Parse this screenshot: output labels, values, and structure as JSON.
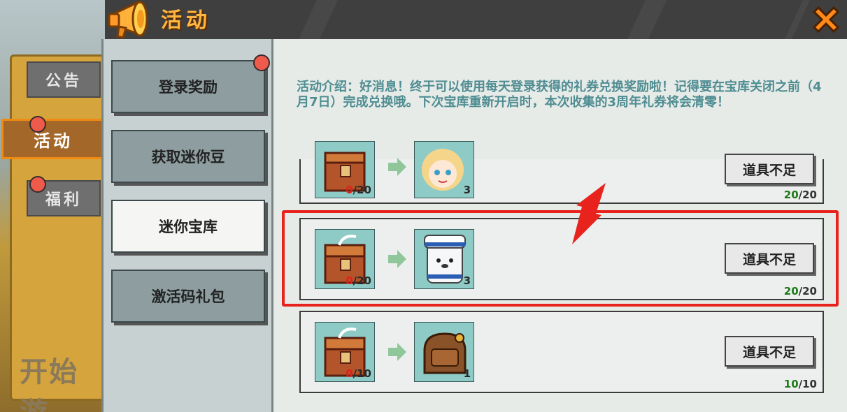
{
  "header": {
    "title": "活动",
    "close_icon": "close-icon"
  },
  "left_tabs": [
    {
      "label": "公告",
      "active": false,
      "dot": false
    },
    {
      "label": "活动",
      "active": true,
      "dot": true
    },
    {
      "label": "福利",
      "active": false,
      "dot": true
    }
  ],
  "background": {
    "start_text": "开始游"
  },
  "nav": [
    {
      "label": "登录奖励",
      "selected": false,
      "dot": true
    },
    {
      "label": "获取迷你豆",
      "selected": false,
      "dot": false
    },
    {
      "label": "迷你宝库",
      "selected": true,
      "dot": false
    },
    {
      "label": "激活码礼包",
      "selected": false,
      "dot": false
    }
  ],
  "intro": "活动介绍：好消息！终于可以使用每天登录获得的礼券兑换奖励啦！记得要在宝库关闭之前（4月7日）完成兑换哦。下次宝库重新开启时，本次收集的3周年礼券将会清零！",
  "rows": [
    {
      "cost_have": "0",
      "cost_need": "/20",
      "reward_count": "3",
      "button": "道具不足",
      "progress_done": "20",
      "progress_total": "/20",
      "reward_icon": "blonde-girl-avatar-icon"
    },
    {
      "cost_have": "0",
      "cost_need": "/20",
      "reward_count": "3",
      "button": "道具不足",
      "progress_done": "20",
      "progress_total": "/20",
      "reward_icon": "sailor-bear-avatar-icon"
    },
    {
      "cost_have": "0",
      "cost_need": "/10",
      "reward_count": "1",
      "button": "道具不足",
      "progress_done": "10",
      "progress_total": "/10",
      "reward_icon": "backpack-icon"
    }
  ],
  "colors": {
    "accent": "#ffb640",
    "highlight": "#e8231d",
    "intro_text": "#4f8d92",
    "progress_green": "#1f7a1a"
  }
}
